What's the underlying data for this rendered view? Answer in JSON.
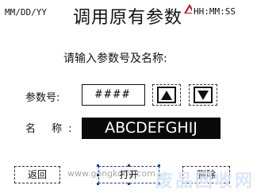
{
  "header": {
    "date": "MM/DD/YY",
    "title": "调用原有参数",
    "time": "HH:MM:SS"
  },
  "prompt": "请输入参数号及名称:",
  "param": {
    "label": "参数号:",
    "value": "####",
    "up_icon": "arrow-up-icon",
    "down_icon": "arrow-down-icon"
  },
  "name": {
    "label": "名 称:",
    "value": "ABCDEFGHIJ"
  },
  "buttons": {
    "back": "返回",
    "open": "打开",
    "delete": "删除"
  },
  "watermark": {
    "url": "www.gongkong.com",
    "text": "废品回收网"
  },
  "colors": {
    "name_bg": "#0a0a0a",
    "watermark": "#1e6ed2",
    "selection": "#1a3aaa"
  }
}
